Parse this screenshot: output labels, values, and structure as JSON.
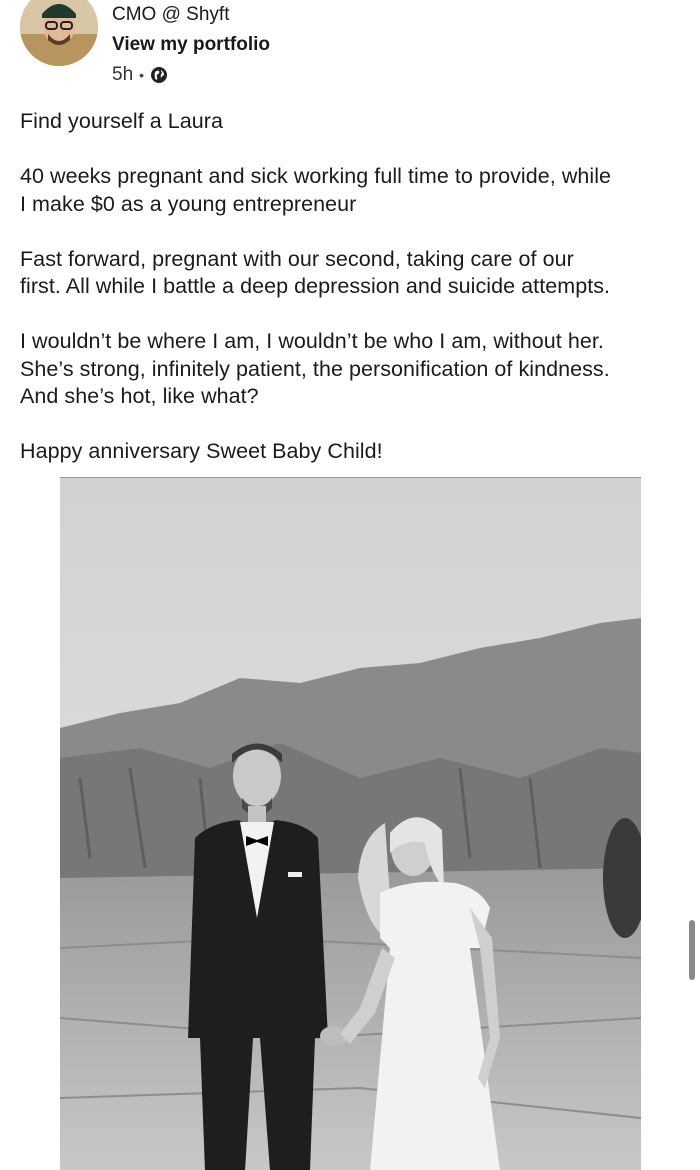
{
  "author": {
    "subtitle": "CMO @ Shyft",
    "portfolio_link": "View my portfolio",
    "time_ago": "5h",
    "separator": "•",
    "visibility_icon": "globe-icon"
  },
  "post": {
    "paragraphs": [
      "Find yourself a Laura",
      "40 weeks pregnant and sick working full time to provide, while\nI make $0 as a young entrepreneur",
      "Fast forward, pregnant with our second, taking care of our\nfirst. All while I battle a deep depression and suicide attempts.",
      "I wouldn’t be where I am, I wouldn’t be who I am, without her.\nShe’s strong, infinitely patient, the personification of kindness.\nAnd she’s hot, like what?",
      "Happy anniversary Sweet Baby Child!"
    ]
  },
  "photo": {
    "subject": "couple-photo"
  },
  "colors": {
    "text": "#1a1a1a",
    "meta": "#333333",
    "scrollbar": "#8a8a8a"
  }
}
